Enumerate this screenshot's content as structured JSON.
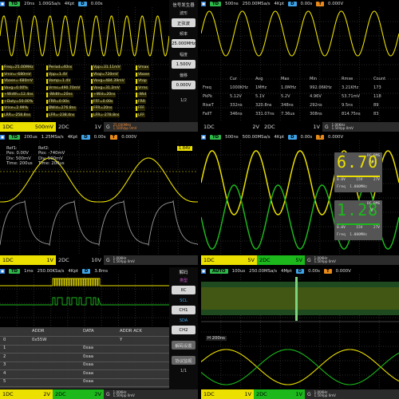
{
  "panel1": {
    "tag": "TD",
    "time": "20ns",
    "rate": "1.00GSa/s",
    "depth": "4Kpt",
    "delay": "0.00s",
    "menu": {
      "title": "信号发生器",
      "b1": "正弦波",
      "b2": "25.000MHz",
      "b3": "1.500V",
      "b4": "0.000V",
      "page": "1/2"
    },
    "meas": [
      [
        "Freq=25.00MHz",
        "Period=40ns",
        "Vpp=31.11mV",
        "Vmax"
      ],
      [
        "Vmin=-680mV",
        "Vpp=1.4V",
        "Vtop=720mV",
        "Vbase"
      ],
      [
        "Vbase=-680mV",
        "Vamp=1.4V",
        "Vavg=484.39mV",
        "Vtop"
      ],
      [
        "Vavg=0.00%",
        "Vrms=490.70mV",
        "Vavg=31.2mV",
        "Vrms"
      ],
      [
        "+Width=12.4ns",
        "-Width=20ns",
        "+Wid=20ns",
        "-Wid"
      ],
      [
        "+Duty=50.00%",
        "FRR=0.00s",
        "FFF=0.00s",
        "FRR"
      ],
      [
        "Vrise=2.99%",
        "BWid=276.8ns",
        "FFR=20ns",
        "FFF"
      ],
      [
        "LRR=-258.8ns",
        "LFR=-238.4ns",
        "LFR=-278.8ns",
        "LFF"
      ]
    ],
    "ch1": "1DC",
    "ch1v": "500mV",
    "ch2": "2DC",
    "ch2v": "1V",
    "g": "G",
    "gtxt1": "25.000MHz",
    "gtxt2": "1.500Vpp  0mV"
  },
  "panel2": {
    "tag": "TD",
    "time": "500ns",
    "rate": "250.00MSa/s",
    "depth": "4Kpt",
    "delay": "0.00s",
    "trig": "0.000V",
    "cols": [
      "",
      "Cur",
      "Avg",
      "Max",
      "Min",
      "Rmse",
      "Count"
    ],
    "rows": [
      [
        "Freq",
        "1000KHz",
        "1MHz",
        "1.0MHz",
        "992.06KHz",
        "3.21KHz",
        "173"
      ],
      [
        "PkPk",
        "5.12V",
        "5.1V",
        "5.2V",
        "4.96V",
        "53.71mV",
        "118"
      ],
      [
        "RiseT",
        "332ns",
        "320.8ns",
        "348ns",
        "292ns",
        "9.5ns",
        "89"
      ],
      [
        "FallT",
        "346ns",
        "331.07ns",
        "7.36us",
        "308ns",
        "814.75ns",
        "83"
      ]
    ],
    "ch1": "1DC",
    "ch1v": "2V",
    "ch2": "2DC",
    "ch2v": "1V",
    "g": "G",
    "gtxt1": "1.00KHz",
    "gtxt2": "1.50Vpp  0mV"
  },
  "panel3": {
    "tag": "TD",
    "time": "200us",
    "rate": "1.25MSa/s",
    "depth": "4Kpt",
    "delay": "0.00s",
    "trig": "0.000V",
    "ref1": [
      "Ref1:",
      "Pos: 0.00V",
      "Div: 500mV",
      "Time: 200us"
    ],
    "ref2": [
      "Ref2:",
      "Pos: -740mV",
      "Div: 500mV",
      "Time: 200us"
    ],
    "level": "1.84V",
    "ch1": "1DC",
    "ch1v": "1V",
    "ch2": "2DC",
    "ch2v": "10V",
    "g": "G",
    "gtxt1": "1.00KHz",
    "gtxt2": "1.50Vpp  0mV"
  },
  "panel4": {
    "tag": "TD",
    "time": "500ns",
    "rate": "500.00MSa/s",
    "depth": "4Kpt",
    "delay": "0.00s",
    "trig": "0.000V",
    "rms1": {
      "big": "6.70",
      "unit": "DC RMS",
      "v": "V",
      "l1": "0.0V",
      "l2": "15V",
      "l3": "27V",
      "freq": "Freq",
      "fval": "1.000MHz"
    },
    "rms2": {
      "big": "1.28",
      "unit": "DC RMS",
      "v": "V",
      "l1": "0.0V",
      "l2": "15V",
      "l3": "27V",
      "freq": "Freq",
      "fval": "1.000MHz"
    },
    "ch1": "1DC",
    "ch1v": "5V",
    "ch2": "2DC",
    "ch2v": "5V",
    "g": "G",
    "gtxt1": "1.00KHz",
    "gtxt2": "1.50Vpp  0mV"
  },
  "panel5": {
    "tag": "TD",
    "time": "1ms",
    "rate": "250.00KSa/s",
    "depth": "4Kpt",
    "delay": "3.8ms",
    "menu": {
      "title": "解码",
      "b1": "类型",
      "b1v": "IIC",
      "b2": "SCL",
      "b2v": "CH1",
      "b3": "SDA",
      "b3v": "CH2",
      "b4": "解码设置",
      "b5": "协议监视",
      "page": "1/1"
    },
    "cols": [
      "",
      "ADDR",
      "DATA",
      "ADDR ACK"
    ],
    "rows": [
      [
        "0",
        "0x55W",
        "",
        "Y"
      ],
      [
        "1",
        "",
        "0xaa",
        ""
      ],
      [
        "2",
        "",
        "0xaa",
        ""
      ],
      [
        "3",
        "",
        "0xaa",
        ""
      ],
      [
        "4",
        "",
        "0xaa",
        ""
      ],
      [
        "5",
        "",
        "0xaa",
        ""
      ]
    ],
    "ch1": "1DC",
    "ch1v": "2V",
    "ch2": "2DC",
    "ch2v": "2V",
    "g": "G",
    "gtxt1": "1.00KHz",
    "gtxt2": "1.50Vpp  0mV"
  },
  "panel6": {
    "tag": "AUTO",
    "time": "100us",
    "rate": "250.00MSa/s",
    "depth": "4Mpt",
    "delay": "0.00s",
    "trig": "0.000V",
    "zoom": "H 200ns",
    "ch1": "1DC",
    "ch1v": "1V",
    "ch2": "2DC",
    "ch2v": "1V",
    "g": "G",
    "gtxt1": "1.00KHz",
    "gtxt2": "1.50Vpp  0mV"
  },
  "colors": {
    "ch1": "#ece000",
    "ch2": "#1cb81c",
    "grid": "#333333",
    "accent": "#2db84a"
  }
}
